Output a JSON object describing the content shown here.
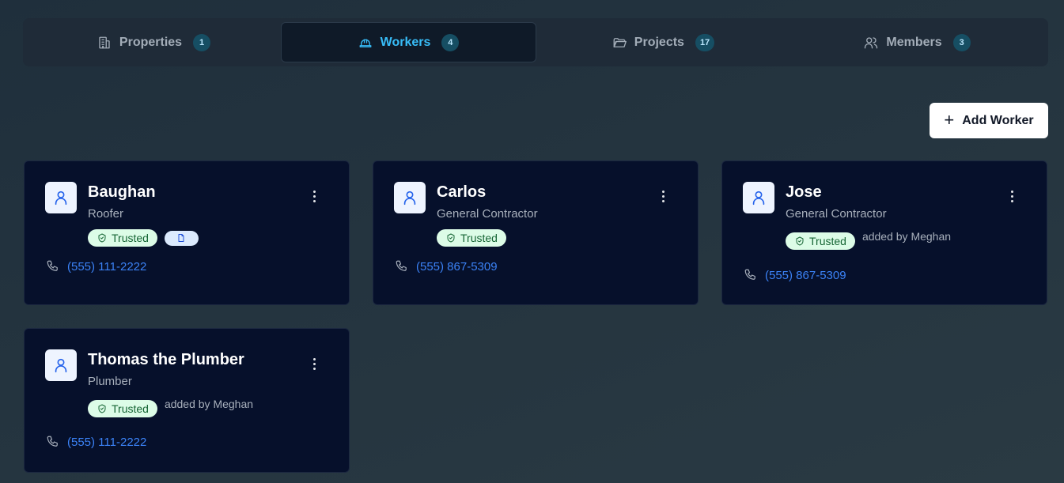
{
  "tabs": [
    {
      "label": "Properties",
      "count": "1",
      "icon": "building-icon",
      "active": false
    },
    {
      "label": "Workers",
      "count": "4",
      "icon": "hardhat-icon",
      "active": true
    },
    {
      "label": "Projects",
      "count": "17",
      "icon": "folder-icon",
      "active": false
    },
    {
      "label": "Members",
      "count": "3",
      "icon": "users-icon",
      "active": false
    }
  ],
  "toolbar": {
    "add_worker_label": "Add Worker"
  },
  "workers": [
    {
      "name": "Baughan",
      "role": "Roofer",
      "trusted_label": "Trusted",
      "has_document": true,
      "added_by": "",
      "phone": "(555) 111-2222"
    },
    {
      "name": "Carlos",
      "role": "General Contractor",
      "trusted_label": "Trusted",
      "has_document": false,
      "added_by": "",
      "phone": "(555) 867-5309"
    },
    {
      "name": "Jose",
      "role": "General Contractor",
      "trusted_label": "Trusted",
      "has_document": false,
      "added_by": "added by Meghan",
      "phone": "(555) 867-5309"
    },
    {
      "name": "Thomas the Plumber",
      "role": "Plumber",
      "trusted_label": "Trusted",
      "has_document": false,
      "added_by": "added by Meghan",
      "phone": "(555) 111-2222"
    }
  ],
  "colors": {
    "accent": "#38bdf8",
    "card_bg": "#06102b",
    "trusted_bg": "#dcfce7",
    "trusted_fg": "#166534",
    "phone_link": "#3b82f6"
  }
}
